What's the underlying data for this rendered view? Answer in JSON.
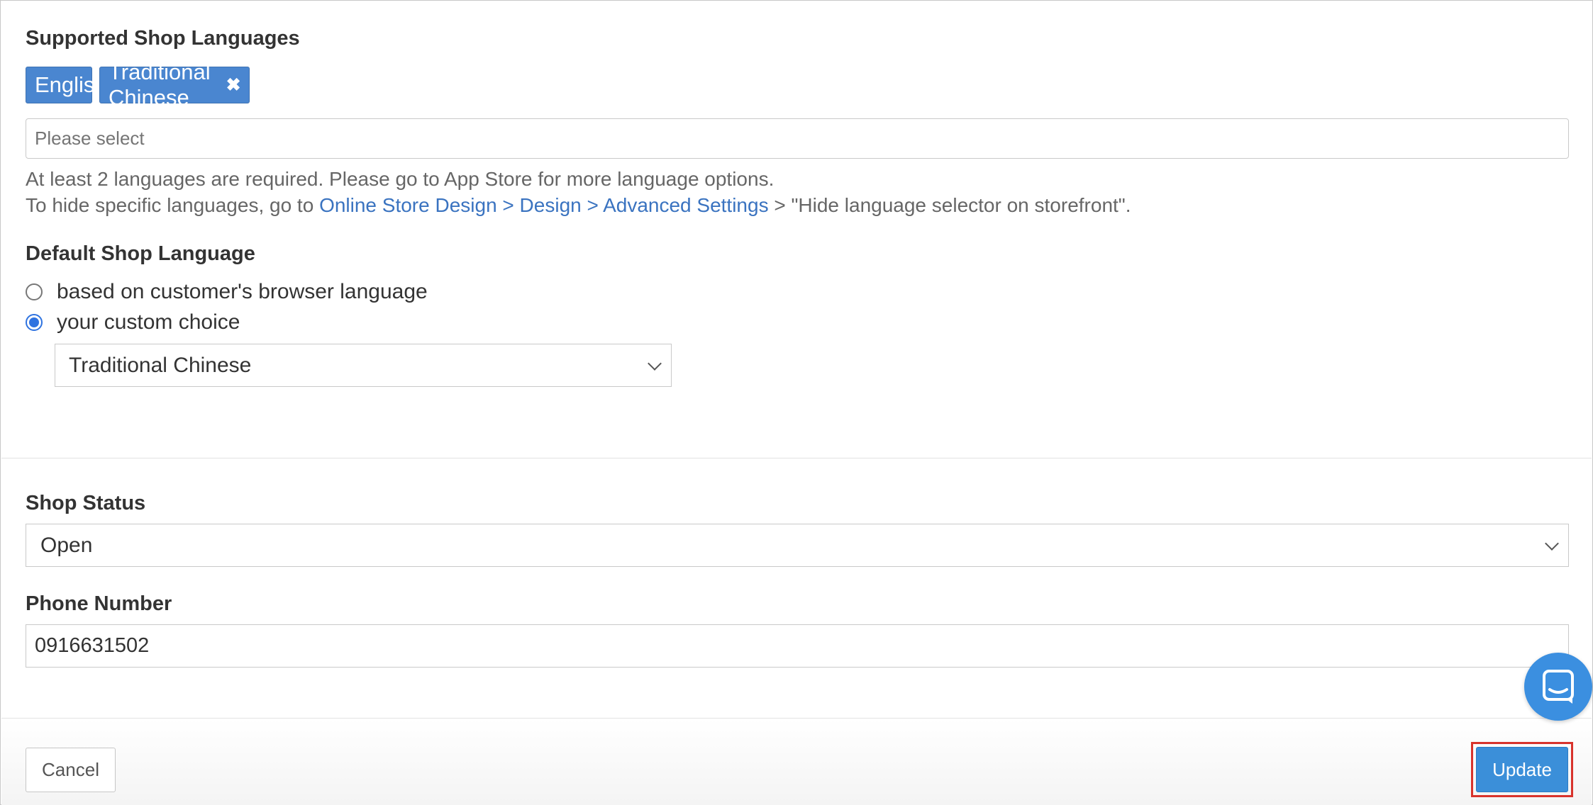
{
  "languages": {
    "label": "Supported Shop Languages",
    "tags": [
      {
        "text": "English",
        "removable": false
      },
      {
        "text": "Traditional Chinese",
        "removable": true
      }
    ],
    "remove_glyph": "✖",
    "input_placeholder": "Please select",
    "help_line1": "At least 2 languages are required. Please go to App Store for more language options.",
    "help_line2_prefix": "To hide specific languages, go to ",
    "help_line2_link": "Online Store Design > Design > Advanced Settings",
    "help_line2_suffix": " > \"Hide language selector on storefront\"."
  },
  "default_language": {
    "label": "Default Shop Language",
    "options": [
      {
        "text": "based on customer's browser language",
        "selected": false
      },
      {
        "text": "your custom choice",
        "selected": true
      }
    ],
    "select_value": "Traditional Chinese"
  },
  "shop_status": {
    "label": "Shop Status",
    "value": "Open"
  },
  "phone": {
    "label": "Phone Number",
    "value": "0916631502"
  },
  "footer": {
    "cancel_label": "Cancel",
    "update_label": "Update"
  },
  "colors": {
    "tag_bg": "#4a86d0",
    "link": "#3a73c0",
    "primary_button": "#3b8fd9",
    "highlight_outline": "#d8332c",
    "chat_bubble": "#3b8fe0"
  }
}
